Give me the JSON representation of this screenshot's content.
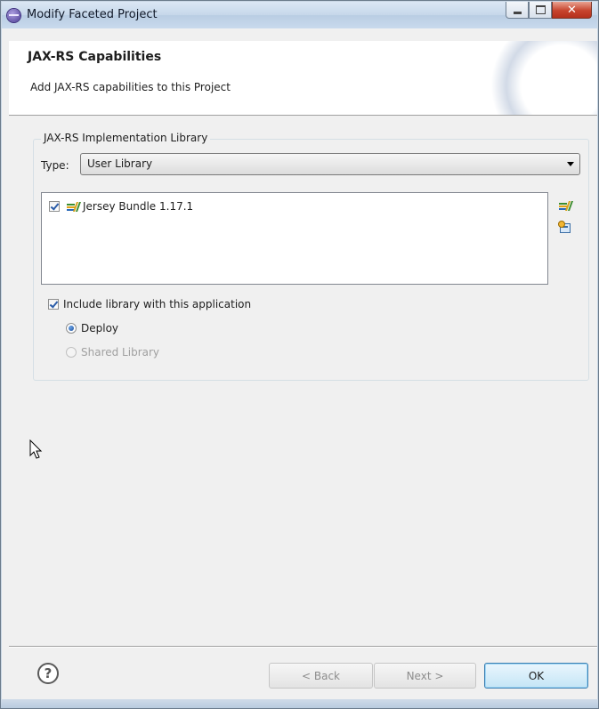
{
  "window": {
    "title": "Modify Faceted Project",
    "controls": {
      "minimize": "minimize",
      "maximize": "maximize",
      "close": "✕"
    }
  },
  "banner": {
    "title": "JAX-RS Capabilities",
    "description": "Add JAX-RS capabilities to this Project"
  },
  "implementation": {
    "group_label": "JAX-RS Implementation Library",
    "type_label": "Type:",
    "type_value": "User Library",
    "libraries": [
      {
        "name": "Jersey Bundle 1.17.1",
        "checked": true
      }
    ],
    "include_label": "Include library with this application",
    "include_checked": true,
    "deploy_label": "Deploy",
    "shared_label": "Shared Library",
    "selected_option": "Deploy"
  },
  "footer": {
    "help_symbol": "?",
    "back_label": "< Back",
    "next_label": "Next >",
    "ok_label": "OK"
  },
  "icons": {
    "title_icon": "eclipse-icon",
    "library_icon": "library-books-icon",
    "add_library_icon": "add-library-icon",
    "manage_libraries_icon": "manage-libraries-icon",
    "cursor_icon": "mouse-pointer-icon",
    "help_icon": "help-icon"
  },
  "colors": {
    "title_bar": "#c6d7ea",
    "close_button": "#c7442e",
    "ok_button_border": "#3c7fb1",
    "dialog_bg": "#f0f0f0"
  }
}
